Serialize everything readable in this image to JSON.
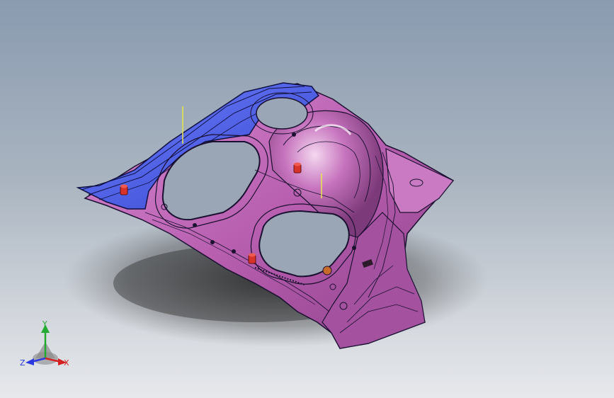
{
  "viewport": {
    "colors": {
      "panel_main": "#c06ab8",
      "panel_blue": "#4a5ee8",
      "edge": "#1a1030",
      "fastener": "#d8332a",
      "marker": "#e6e64a"
    }
  },
  "model": {
    "name": "sheet-metal-panel"
  },
  "triad": {
    "x_label": "X",
    "y_label": "Y",
    "z_label": "Z",
    "colors": {
      "x": "#d42020",
      "y": "#22aa33",
      "z": "#2a3ae0"
    }
  }
}
